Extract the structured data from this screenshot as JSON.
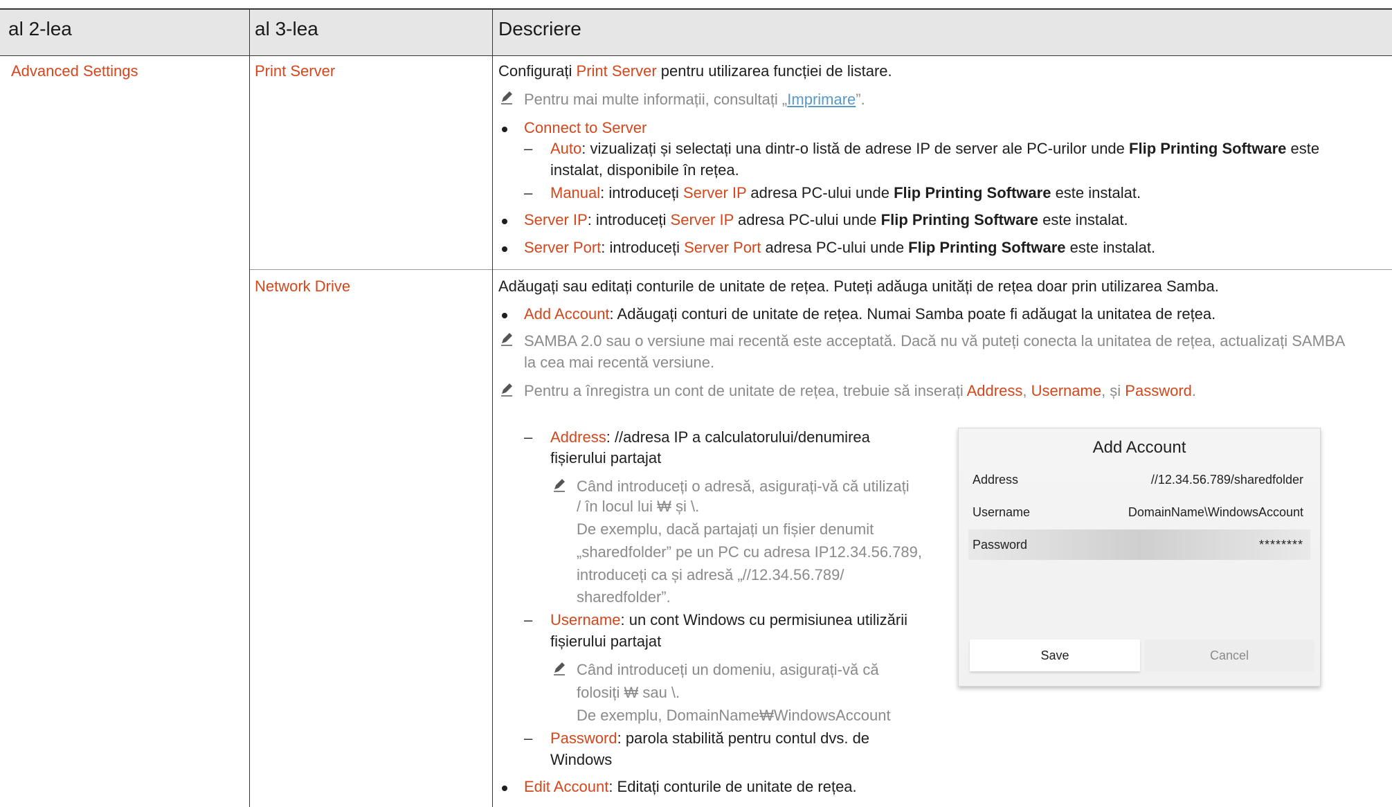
{
  "headers": {
    "col1": "al 2-lea",
    "col2": "al 3-lea",
    "col3": "Descriere"
  },
  "col1": {
    "advanced_settings": "Advanced Settings"
  },
  "print_server": {
    "name": "Print Server",
    "desc_pre": "Configurați ",
    "desc_term": "Print Server",
    "desc_post": " pentru utilizarea funcției de listare.",
    "note_pre": "Pentru mai multe informații, consultați „",
    "note_link": "Imprimare",
    "note_post": "”.",
    "connect_to_server": "Connect to Server",
    "auto_term": "Auto",
    "auto_text1": ": vizualizați și selectați una dintr-o listă de adrese IP de server ale PC-urilor unde ",
    "auto_bold": "Flip Printing Software",
    "auto_text2": " este",
    "auto_line2": "instalat, disponibile în rețea.",
    "manual_term": "Manual",
    "manual_text1": ": introduceți ",
    "manual_term2": "Server IP",
    "manual_text2": " adresa PC-ului unde ",
    "manual_bold": "Flip Printing Software",
    "manual_text3": " este instalat.",
    "server_ip_term": "Server IP",
    "server_ip_text1": ": introduceți ",
    "server_ip_term2": "Server IP",
    "server_ip_text2": " adresa PC-ului unde ",
    "server_ip_bold": "Flip Printing Software",
    "server_ip_text3": " este instalat.",
    "server_port_term": "Server Port",
    "server_port_text1": ": introduceți ",
    "server_port_term2": "Server Port",
    "server_port_text2": " adresa PC-ului unde ",
    "server_port_bold": "Flip Printing Software",
    "server_port_text3": " este instalat."
  },
  "network_drive": {
    "name": "Network Drive",
    "intro": "Adăugați sau editați conturile de unitate de rețea. Puteți adăuga unități de rețea doar prin utilizarea Samba.",
    "add_account_term": "Add Account",
    "add_account_text": ": Adăugați conturi de unitate de rețea. Numai Samba poate fi adăugat la unitatea de rețea.",
    "samba_note_line1": "SAMBA 2.0 sau o versiune mai recentă este acceptată. Dacă nu vă puteți conecta la unitatea de rețea, actualizați SAMBA",
    "samba_note_line2": "la cea mai recentă versiune.",
    "register_note_pre": "Pentru a înregistra un cont de unitate de rețea, trebuie să inserați ",
    "register_address": "Address",
    "register_sep1": ", ",
    "register_username": "Username",
    "register_sep2": ", și ",
    "register_password": "Password",
    "register_end": ".",
    "address_term": "Address",
    "address_text1": ": //adresa IP a calculatorului/denumirea",
    "address_text2": "fișierului partajat",
    "address_note1": "Când introduceți o adresă, asigurați-vă că utilizați",
    "address_note2": "/ în locul lui ₩ și \\.",
    "address_note3": "De exemplu, dacă partajați un fișier denumit",
    "address_note4": "„sharedfolder” pe un PC cu adresa IP12.34.56.789,",
    "address_note5": "introduceți ca și adresă „//12.34.56.789/",
    "address_note6": "sharedfolder”.",
    "username_term": "Username",
    "username_text1": ": un cont Windows cu permisiunea utilizării",
    "username_text2": "fișierului partajat",
    "username_note1": "Când introduceți un domeniu, asigurați-vă că",
    "username_note2": "folosiți ₩ sau \\.",
    "username_note3": "De exemplu, DomainName₩WindowsAccount",
    "password_term": "Password",
    "password_text1": ": parola stabilită pentru contul dvs. de",
    "password_text2": "Windows",
    "edit_account_term": "Edit Account",
    "edit_account_text": ": Editați conturile de unitate de rețea."
  },
  "dialog": {
    "title": "Add Account",
    "address_label": "Address",
    "address_value": "//12.34.56.789/sharedfolder",
    "username_label": "Username",
    "username_value": "DomainName\\WindowsAccount",
    "password_label": "Password",
    "password_value": "********",
    "save": "Save",
    "cancel": "Cancel"
  },
  "colors": {
    "accent": "#d4461b",
    "header_bg": "#e6e6e6",
    "note_gray": "#8a8a8a",
    "link": "#5a97c9"
  }
}
